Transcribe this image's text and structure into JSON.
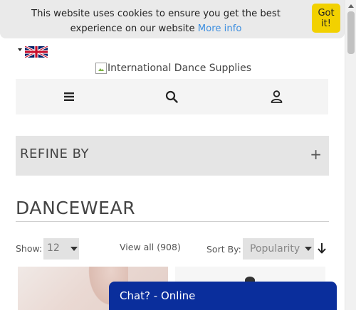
{
  "cookie": {
    "message": "This website uses cookies to ensure you get the best experience on our website",
    "more_info": "More info",
    "button": "Got it!"
  },
  "language": {
    "flag": "uk-flag-icon"
  },
  "logo": {
    "alt": "International Dance Supplies"
  },
  "nav": {
    "menu_icon": "hamburger-menu-icon",
    "search_icon": "search-icon",
    "account_icon": "user-account-icon"
  },
  "refine": {
    "label": "REFINE BY",
    "toggle": "+"
  },
  "category": {
    "title": "DANCEWEAR"
  },
  "toolbar": {
    "show_label": "Show:",
    "show_value": "12",
    "view_all": "View all (908)",
    "sort_label": "Sort By:",
    "sort_value": "Popularity",
    "sort_direction_icon": "arrow-down-icon"
  },
  "chat": {
    "label": "Chat? - Online"
  },
  "colors": {
    "cookie_button": "#f2d100",
    "link": "#3d8fe0",
    "chat_bg": "#0a2e9c"
  }
}
